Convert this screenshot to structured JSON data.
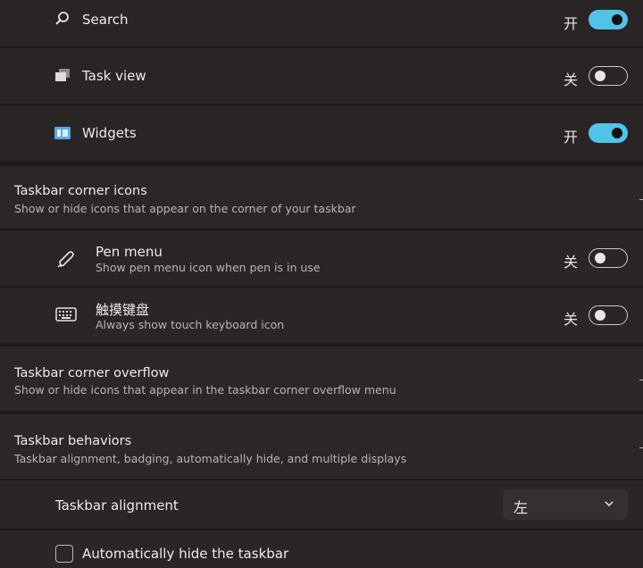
{
  "taskbar_items": [
    {
      "label": "Search",
      "state": "开",
      "on": true
    },
    {
      "label": "Task view",
      "state": "关",
      "on": false
    },
    {
      "label": "Widgets",
      "state": "开",
      "on": true
    }
  ],
  "corner_icons": {
    "title": "Taskbar corner icons",
    "description": "Show or hide icons that appear on the corner of your taskbar",
    "items": [
      {
        "label": "Pen menu",
        "description": "Show pen menu icon when pen is in use",
        "state": "关",
        "on": false
      },
      {
        "label": "触摸键盘",
        "description": "Always show touch keyboard icon",
        "state": "关",
        "on": false
      }
    ]
  },
  "corner_overflow": {
    "title": "Taskbar corner overflow",
    "description": "Show or hide icons that appear in the taskbar corner overflow menu"
  },
  "behaviors": {
    "title": "Taskbar behaviors",
    "description": "Taskbar alignment, badging, automatically hide, and multiple displays",
    "alignment_label": "Taskbar alignment",
    "alignment_value": "左",
    "autohide_label": "Automatically hide the taskbar"
  },
  "colors": {
    "accent": "#4fc3e8",
    "background": "#1e1a1a",
    "card": "#2a2525"
  }
}
